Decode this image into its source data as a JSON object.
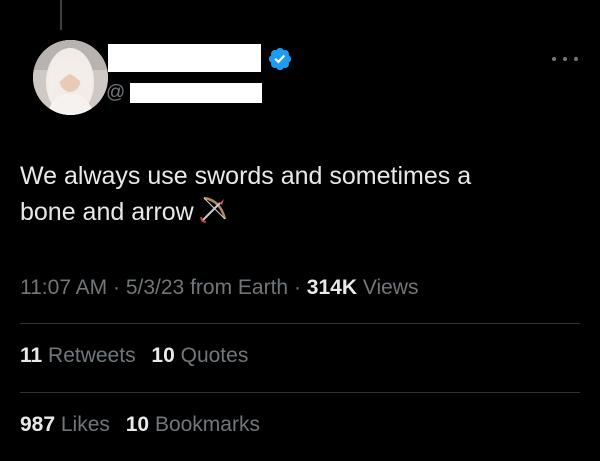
{
  "tweet": {
    "author": {
      "handle_prefix": "@",
      "verified": true
    },
    "text_line1": "We always use swords and sometimes a",
    "text_line2": "bone and arrow",
    "emoji": "bow-and-arrow",
    "meta": {
      "time": "11:07 AM",
      "sep1": " · ",
      "date": "5/3/23",
      "source": " from Earth",
      "sep2": " · ",
      "views_count": "314K",
      "views_label": " Views"
    },
    "stats": {
      "retweets_count": "11",
      "retweets_label": " Retweets",
      "quotes_count": "10",
      "quotes_label": " Quotes",
      "likes_count": "987",
      "likes_label": " Likes",
      "bookmarks_count": "10",
      "bookmarks_label": " Bookmarks"
    }
  },
  "colors": {
    "background": "#000000",
    "primary_text": "#e7e9ea",
    "secondary_text": "#71767b",
    "divider": "#2f3336",
    "verified_blue": "#1d9bf0"
  }
}
